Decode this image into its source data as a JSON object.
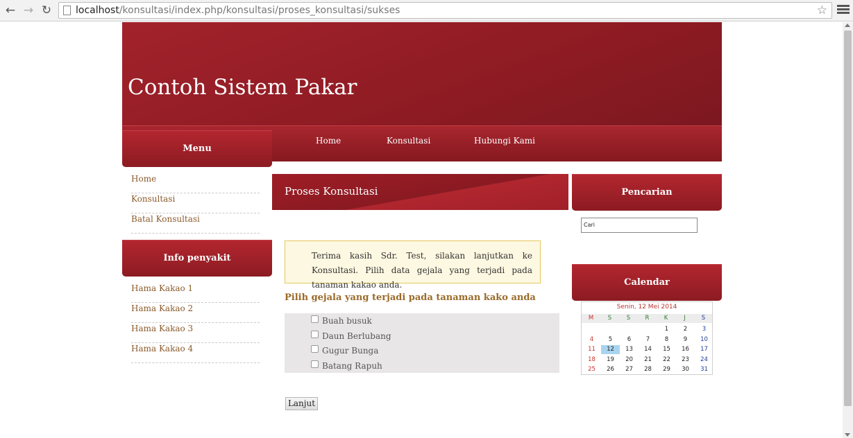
{
  "browser": {
    "url_host": "localhost",
    "url_path": "/konsultasi/index.php/konsultasi/proses_konsultasi/sukses"
  },
  "header": {
    "site_title": "Contoh Sistem Pakar"
  },
  "nav": [
    "Home",
    "Konsultasi",
    "Hubungi Kami"
  ],
  "menu": {
    "title": "Menu",
    "items": [
      "Home",
      "Konsultasi",
      "Batal Konsultasi"
    ]
  },
  "info_penyakit": {
    "title": "Info penyakit",
    "items": [
      "Hama Kakao 1",
      "Hama Kakao 2",
      "Hama Kakao 3",
      "Hama Kakao 4"
    ]
  },
  "main": {
    "title": "Proses Konsultasi",
    "info_text": "Terima kasih Sdr. Test, silakan lanjutkan ke Konsultasi. Pilih data gejala yang terjadi pada tanaman kakao anda.",
    "question": "Pilih gejala yang terjadi pada tanaman kako anda",
    "symptoms": [
      "Buah busuk",
      "Daun Berlubang",
      "Gugur Bunga",
      "Batang Rapuh"
    ],
    "submit_label": "Lanjut"
  },
  "search": {
    "title": "Pencarian",
    "value": "Cari"
  },
  "calendar": {
    "title": "Calendar",
    "date_label": "Senin, 12 Mei 2014",
    "weekdays": [
      "M",
      "S",
      "S",
      "R",
      "K",
      "J",
      "S"
    ],
    "weeks": [
      [
        "",
        "",
        "",
        "",
        "1",
        "2",
        "3"
      ],
      [
        "4",
        "5",
        "6",
        "7",
        "8",
        "9",
        "10"
      ],
      [
        "11",
        "12",
        "13",
        "14",
        "15",
        "16",
        "17"
      ],
      [
        "18",
        "19",
        "20",
        "21",
        "22",
        "23",
        "24"
      ],
      [
        "25",
        "26",
        "27",
        "28",
        "29",
        "30",
        "31"
      ]
    ],
    "today": "12",
    "colors": {
      "sunday": "#c8322d",
      "saturday": "#1f3a9a",
      "weekday": "#222222",
      "header_weekday": "#2e7d32"
    }
  }
}
